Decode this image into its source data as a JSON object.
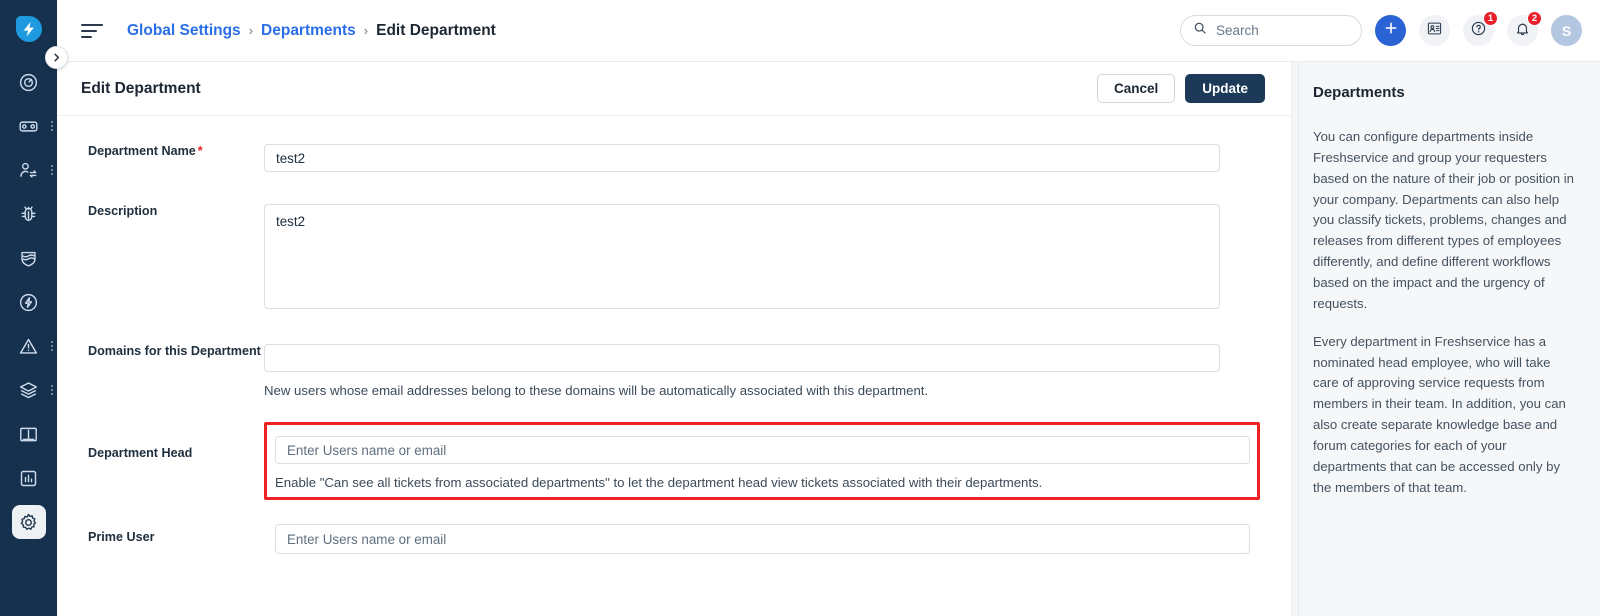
{
  "brand": {
    "logo_icon": "freshservice-bolt-logo",
    "accent": "#2a63d4",
    "rail_bg": "#15314d",
    "highlight": "#ee2222"
  },
  "sidebar": {
    "collapse_icon": "chevron-right-icon",
    "items": [
      {
        "name": "dashboard",
        "icon": "gauge-icon",
        "has_menu": false,
        "active": false
      },
      {
        "name": "tickets",
        "icon": "ticket-icon",
        "has_menu": true,
        "active": false
      },
      {
        "name": "requesters",
        "icon": "user-swap-icon",
        "has_menu": true,
        "active": false
      },
      {
        "name": "problems",
        "icon": "bug-icon",
        "has_menu": false,
        "active": false
      },
      {
        "name": "changes",
        "icon": "shield-icon",
        "has_menu": false,
        "active": false
      },
      {
        "name": "releases",
        "icon": "bolt-circle-icon",
        "has_menu": false,
        "active": false
      },
      {
        "name": "alerts",
        "icon": "alert-triangle-icon",
        "has_menu": true,
        "active": false
      },
      {
        "name": "assets",
        "icon": "layers-icon",
        "has_menu": true,
        "active": false
      },
      {
        "name": "solutions",
        "icon": "book-icon",
        "has_menu": false,
        "active": false
      },
      {
        "name": "analytics",
        "icon": "bar-chart-icon",
        "has_menu": false,
        "active": false
      },
      {
        "name": "admin-settings",
        "icon": "gear-icon",
        "has_menu": false,
        "active": true
      }
    ]
  },
  "topbar": {
    "menu_icon": "hamburger-icon",
    "breadcrumb": {
      "root": "Global Settings",
      "parent": "Departments",
      "current": "Edit Department",
      "separator": "›"
    },
    "search": {
      "placeholder": "Search",
      "value": "",
      "icon": "search-icon"
    },
    "actions": [
      {
        "name": "new-item-button",
        "icon": "plus-icon",
        "badge": ""
      },
      {
        "name": "contacts-button",
        "icon": "contact-card-icon",
        "badge": ""
      },
      {
        "name": "help-button",
        "icon": "question-circle-icon",
        "badge": "1"
      },
      {
        "name": "notifications-button",
        "icon": "bell-icon",
        "badge": "2"
      }
    ],
    "avatar": {
      "initial": "S",
      "name": "user-avatar"
    }
  },
  "page": {
    "title": "Edit Department",
    "cancel_label": "Cancel",
    "update_label": "Update"
  },
  "form": {
    "department_name": {
      "label": "Department Name",
      "required_marker": "*",
      "value": "test2",
      "placeholder": ""
    },
    "description": {
      "label": "Description",
      "value": "test2",
      "placeholder": ""
    },
    "domains": {
      "label": "Domains for this Department",
      "value": "",
      "placeholder": "",
      "helper": "New users whose email addresses belong to these domains will be automatically associated with this department."
    },
    "department_head": {
      "label": "Department Head",
      "value": "",
      "placeholder": "Enter Users name or email",
      "helper": "Enable \"Can see all tickets from associated departments\" to let the department head view tickets associated with their departments.",
      "highlighted": true
    },
    "prime_user": {
      "label": "Prime User",
      "value": "",
      "placeholder": "Enter Users name or email"
    }
  },
  "side_panel": {
    "title": "Departments",
    "paragraphs": [
      "You can configure departments inside Freshservice and group your requesters based on the nature of their job or position in your company. Departments can also help you classify tickets, problems, changes and releases from different types of employees differently, and define different workflows based on the impact and the urgency of requests.",
      "Every department in Freshservice has a nominated head employee, who will take care of approving service requests from members in their team. In addition, you can also create separate knowledge base and forum categories for each of your departments that can be accessed only by the members of that team."
    ]
  }
}
